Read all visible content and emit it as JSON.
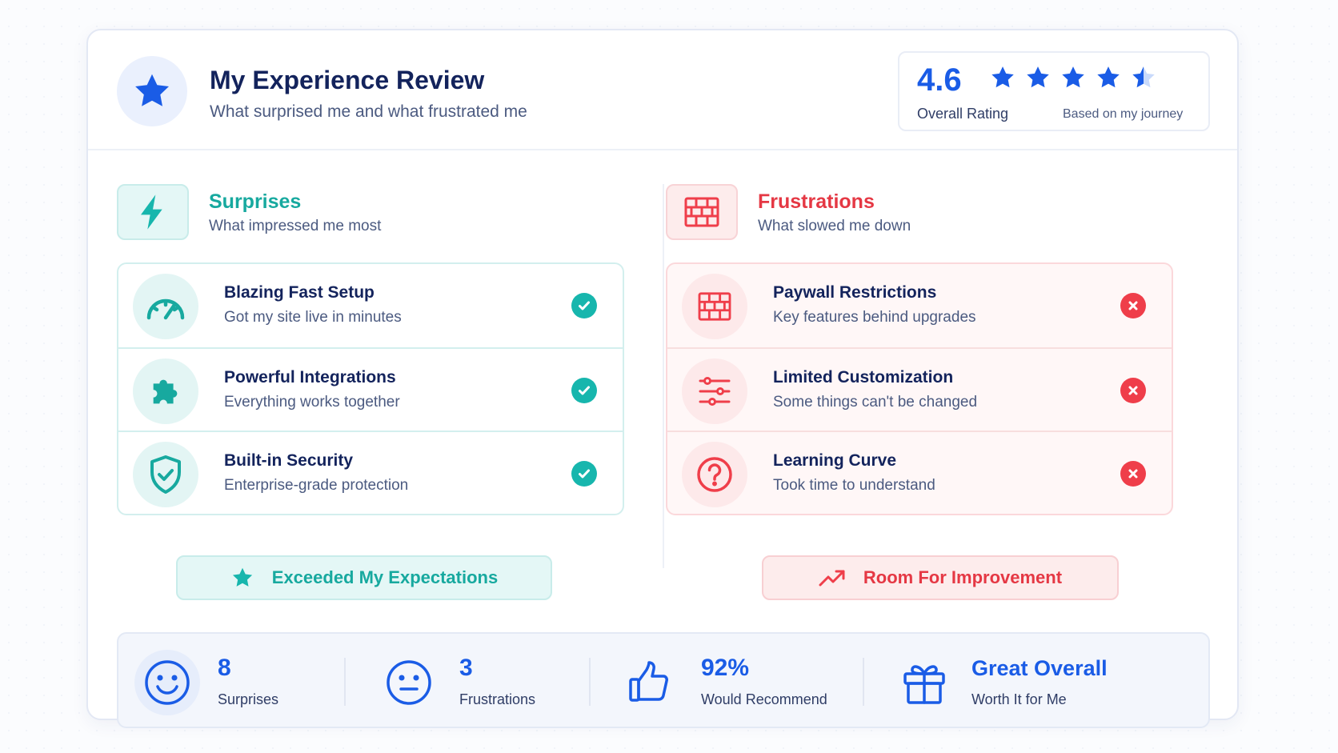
{
  "header": {
    "title": "My Experience Review",
    "subtitle": "What surprised me and what frustrated me",
    "rating": {
      "value": "4.6",
      "label": "Overall Rating",
      "note": "Based on my journey",
      "stars": 4.5,
      "star_color": "#1a5ce6"
    }
  },
  "surprises": {
    "title": "Surprises",
    "subtitle": "What impressed me most",
    "accent": "#17b6ad",
    "icon": "bolt-icon",
    "items": [
      {
        "title": "Blazing Fast Setup",
        "subtitle": "Got my site live in minutes",
        "icon": "speedometer-icon"
      },
      {
        "title": "Powerful Integrations",
        "subtitle": "Everything works together",
        "icon": "puzzle-icon"
      },
      {
        "title": "Built-in Security",
        "subtitle": "Enterprise-grade protection",
        "icon": "shield-check-icon"
      }
    ],
    "badge": "Exceeded My Expectations"
  },
  "frustrations": {
    "title": "Frustrations",
    "subtitle": "What slowed me down",
    "accent": "#ef3e4a",
    "icon": "brick-wall-icon",
    "items": [
      {
        "title": "Paywall Restrictions",
        "subtitle": "Key features behind upgrades",
        "icon": "brick-wall-icon"
      },
      {
        "title": "Limited Customization",
        "subtitle": "Some things can't be changed",
        "icon": "sliders-icon"
      },
      {
        "title": "Learning Curve",
        "subtitle": "Took time to understand",
        "icon": "question-icon"
      }
    ],
    "badge": "Room For Improvement"
  },
  "stats": [
    {
      "value": "8",
      "label": "Surprises",
      "icon": "smile-icon"
    },
    {
      "value": "3",
      "label": "Frustrations",
      "icon": "neutral-face-icon"
    },
    {
      "value": "92%",
      "label": "Would Recommend",
      "icon": "thumbs-up-icon"
    },
    {
      "value": "Great Overall",
      "label": "Worth It for Me",
      "icon": "gift-icon"
    }
  ]
}
